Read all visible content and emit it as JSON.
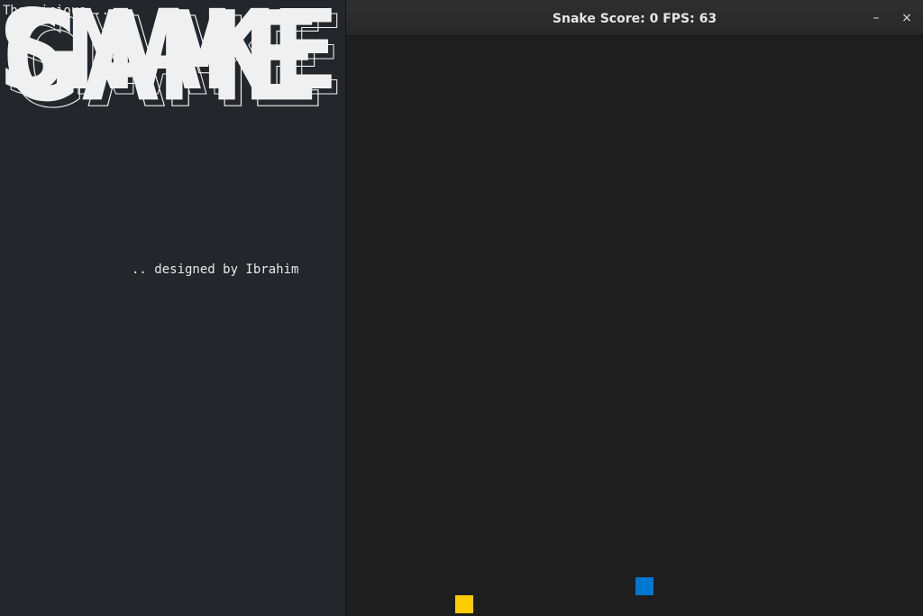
{
  "terminal": {
    "intro_text": "The vicious ..",
    "banner_line1": "SNAKE",
    "banner_line2": "GAME",
    "credit_text": ".. designed by Ibrahim"
  },
  "game_window": {
    "title": "Snake Score: 0 FPS: 63",
    "minimize_label": "–",
    "close_label": "×",
    "snake_color": "#0077d1",
    "food_color": "#ffcc00"
  }
}
